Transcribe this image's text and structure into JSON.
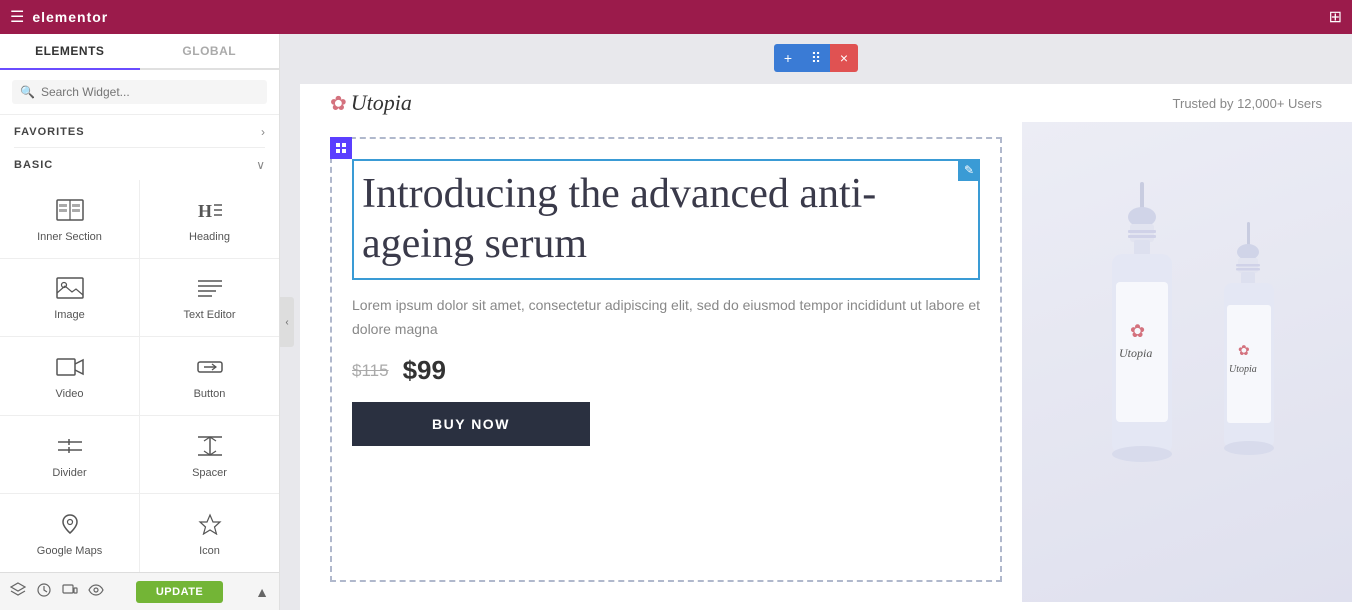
{
  "topbar": {
    "logo": "elementor",
    "hamburger_label": "☰",
    "grid_label": "⊞"
  },
  "sidebar": {
    "tab_elements": "ELEMENTS",
    "tab_global": "GLOBAL",
    "search_placeholder": "Search Widget...",
    "search_icon": "🔍",
    "favorites_label": "FAVORITES",
    "favorites_chevron": "›",
    "basic_label": "BASIC",
    "basic_chevron": "∨",
    "widgets": [
      {
        "id": "inner-section",
        "icon": "inner_section",
        "label": "Inner Section"
      },
      {
        "id": "heading",
        "icon": "heading",
        "label": "Heading"
      },
      {
        "id": "image",
        "icon": "image",
        "label": "Image"
      },
      {
        "id": "text-editor",
        "icon": "text_editor",
        "label": "Text Editor"
      },
      {
        "id": "video",
        "icon": "video",
        "label": "Video"
      },
      {
        "id": "button",
        "icon": "button",
        "label": "Button"
      },
      {
        "id": "divider",
        "icon": "divider",
        "label": "Divider"
      },
      {
        "id": "spacer",
        "icon": "spacer",
        "label": "Spacer"
      },
      {
        "id": "google-maps",
        "icon": "map",
        "label": "Google Maps"
      },
      {
        "id": "icon",
        "icon": "star",
        "label": "Icon"
      }
    ],
    "footer": {
      "update_label": "UPDATE"
    }
  },
  "canvas": {
    "toolbar": {
      "add_label": "+",
      "move_label": "⠿",
      "close_label": "×"
    },
    "brand": {
      "flower": "✿",
      "name": "Utopia",
      "trusted": "Trusted by 12,000+ Users"
    },
    "content": {
      "heading": "Introducing the advanced anti-ageing serum",
      "body": "Lorem ipsum dolor sit amet, consectetur adipiscing elit, sed do eiusmod tempor incididunt ut labore et dolore magna",
      "old_price": "$115",
      "new_price": "$99",
      "buy_button": "BUY NOW"
    }
  }
}
